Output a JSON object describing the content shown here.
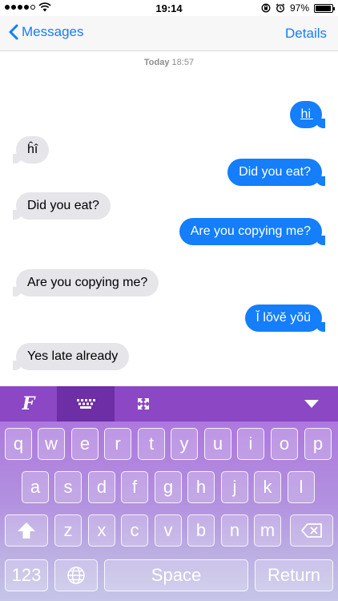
{
  "status_bar": {
    "time": "19:14",
    "battery": "97%",
    "battery_level": 0.97
  },
  "nav": {
    "back_label": "Messages",
    "details_label": "Details"
  },
  "timestamp": {
    "day": "Today",
    "time": "18:57"
  },
  "messages": [
    {
      "direction": "outgoing",
      "text": "h̲i̲"
    },
    {
      "direction": "incoming",
      "text": "ĥî"
    },
    {
      "direction": "outgoing",
      "text": "Did you eat?"
    },
    {
      "direction": "incoming",
      "text": "Did you eat?"
    },
    {
      "direction": "outgoing",
      "text": "Are you copying me?"
    },
    {
      "direction": "incoming",
      "text": "Are you copying me?"
    },
    {
      "direction": "outgoing",
      "text": "Ĭ lŏvĕ yŏŭ"
    },
    {
      "direction": "incoming",
      "text": "Yes late already"
    }
  ],
  "keyboard": {
    "row1": [
      "q",
      "w",
      "e",
      "r",
      "t",
      "y",
      "u",
      "i",
      "o",
      "p"
    ],
    "row2": [
      "a",
      "s",
      "d",
      "f",
      "g",
      "h",
      "j",
      "k",
      "l"
    ],
    "row3": [
      "z",
      "x",
      "c",
      "v",
      "b",
      "n",
      "m"
    ],
    "numbers_label": "123",
    "space_label": "Space",
    "return_label": "Return",
    "toolbar_font_label": "F"
  },
  "colors": {
    "ios_blue": "#147efb",
    "incoming_bubble": "#e5e5ea",
    "toolbar": "#8b47c4",
    "toolbar_active": "#6e2ea6"
  }
}
